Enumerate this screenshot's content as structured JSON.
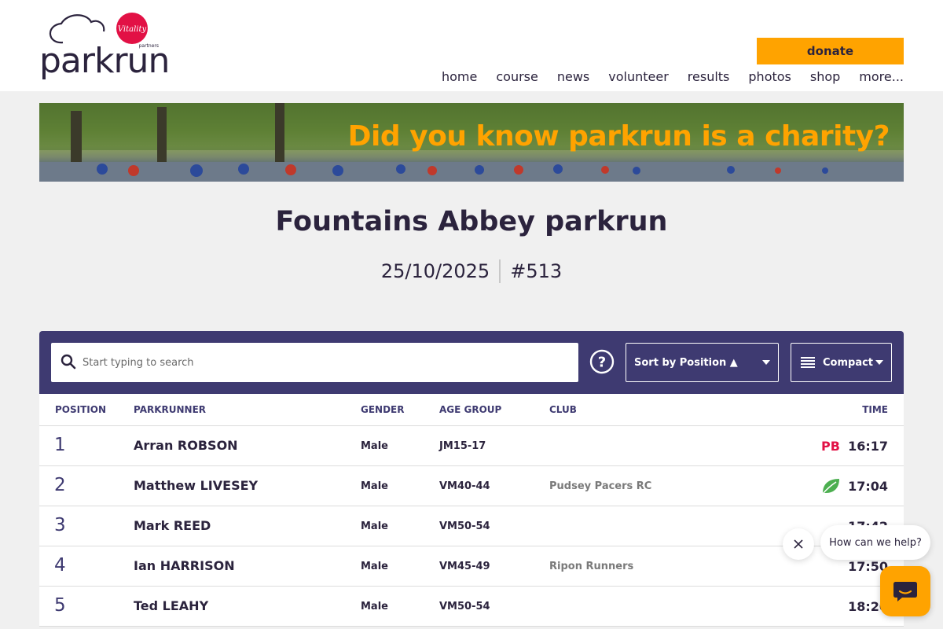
{
  "header": {
    "logo_text": "parkrun",
    "partner_badge": "Vitality",
    "partner_sub": "partners",
    "donate_label": "donate",
    "nav": [
      "home",
      "course",
      "news",
      "volunteer",
      "results",
      "photos",
      "shop",
      "more..."
    ]
  },
  "banner": {
    "text": "Did you know parkrun is a charity?"
  },
  "event": {
    "title": "Fountains Abbey parkrun",
    "date": "25/10/2025",
    "number": "#513"
  },
  "toolbar": {
    "search_placeholder": "Start typing to search",
    "sort_label": "Sort by Position ▲",
    "view_label": "Compact"
  },
  "table": {
    "headers": {
      "position": "POSITION",
      "parkrunner": "PARKRUNNER",
      "gender": "GENDER",
      "age_group": "AGE GROUP",
      "club": "CLUB",
      "time": "TIME"
    },
    "rows": [
      {
        "position": "1",
        "name": "Arran ROBSON",
        "gender": "Male",
        "age_group": "JM15-17",
        "club": "",
        "badge": "PB",
        "time": "16:17"
      },
      {
        "position": "2",
        "name": "Matthew LIVESEY",
        "gender": "Male",
        "age_group": "VM40-44",
        "club": "Pudsey Pacers RC",
        "badge": "leaf-icon",
        "time": "17:04"
      },
      {
        "position": "3",
        "name": "Mark REED",
        "gender": "Male",
        "age_group": "VM50-54",
        "club": "",
        "badge": "",
        "time": "17:42"
      },
      {
        "position": "4",
        "name": "Ian HARRISON",
        "gender": "Male",
        "age_group": "VM45-49",
        "club": "Ripon Runners",
        "badge": "",
        "time": "17:50"
      },
      {
        "position": "5",
        "name": "Ted LEAHY",
        "gender": "Male",
        "age_group": "VM50-54",
        "club": "",
        "badge": "",
        "time": "18:20"
      }
    ]
  },
  "chat": {
    "prompt": "How can we help?"
  },
  "colors": {
    "brand_purple": "#3e3a71",
    "accent_orange": "#ffa300",
    "pb_red": "#e21145",
    "leaf_green": "#4caf50"
  }
}
